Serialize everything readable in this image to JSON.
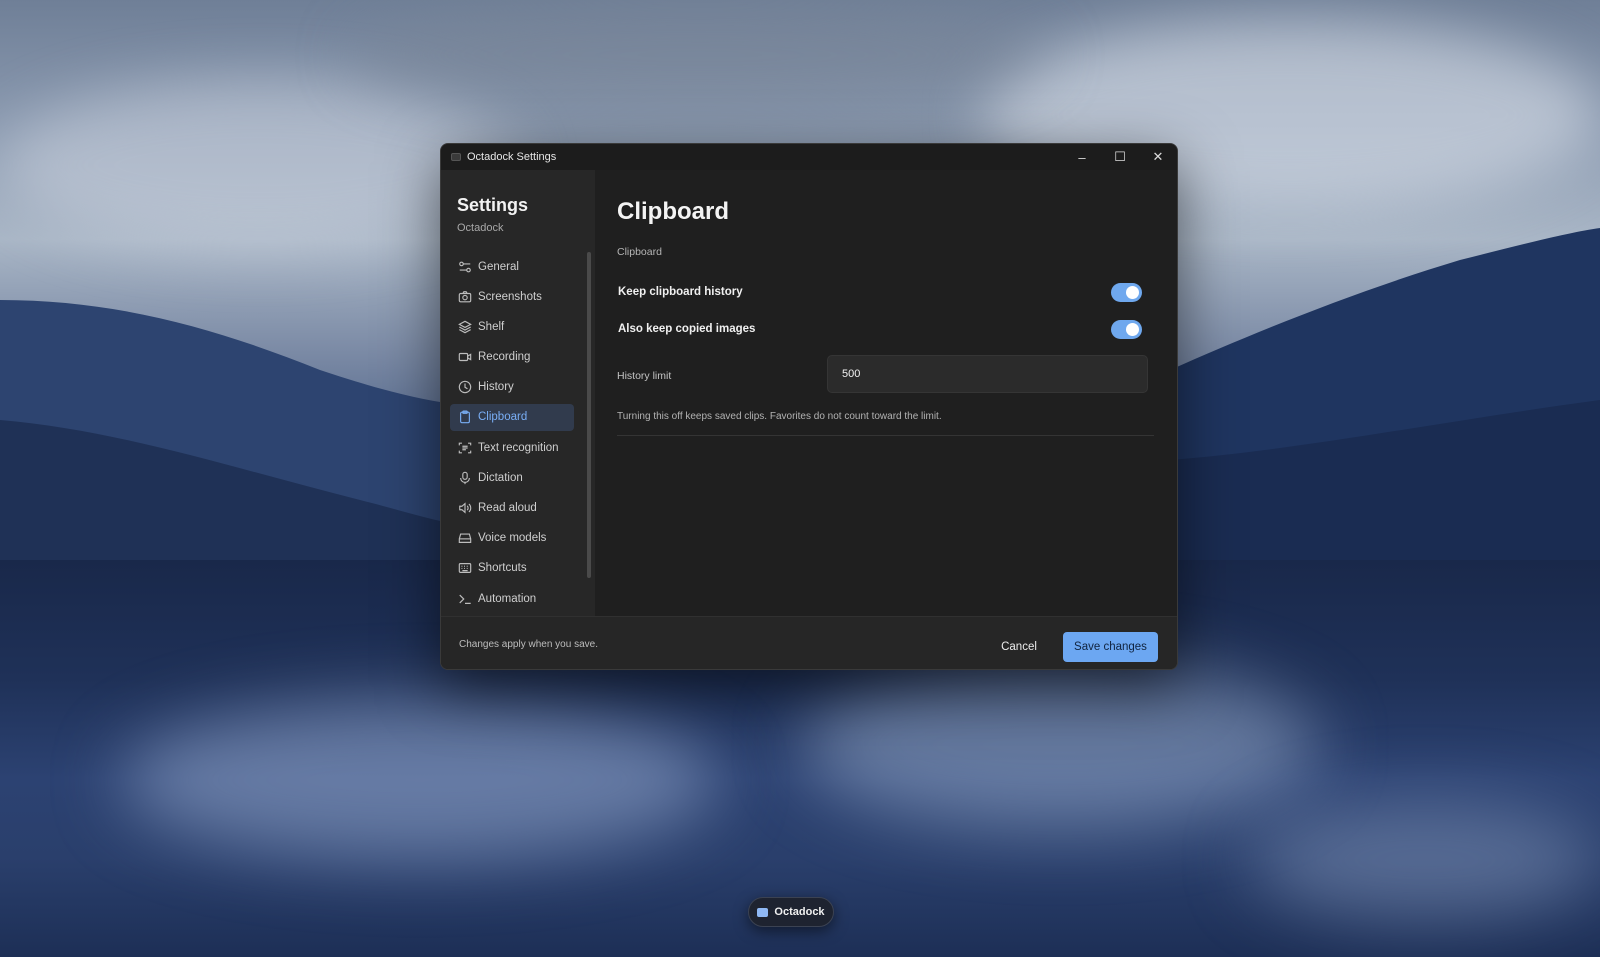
{
  "window": {
    "title": "Octadock Settings",
    "controls": {
      "minimize": "–",
      "maximize": "☐",
      "close": "✕"
    }
  },
  "sidebar": {
    "title": "Settings",
    "subtitle": "Octadock",
    "items": [
      {
        "label": "General",
        "icon": "sliders-icon"
      },
      {
        "label": "Screenshots",
        "icon": "camera-icon"
      },
      {
        "label": "Shelf",
        "icon": "layers-icon"
      },
      {
        "label": "Recording",
        "icon": "video-icon"
      },
      {
        "label": "History",
        "icon": "clock-icon"
      },
      {
        "label": "Clipboard",
        "icon": "clipboard-icon",
        "active": true
      },
      {
        "label": "Text recognition",
        "icon": "scan-text-icon"
      },
      {
        "label": "Dictation",
        "icon": "microphone-icon"
      },
      {
        "label": "Read aloud",
        "icon": "speaker-icon"
      },
      {
        "label": "Voice models",
        "icon": "drive-icon"
      },
      {
        "label": "Shortcuts",
        "icon": "keyboard-icon"
      },
      {
        "label": "Automation",
        "icon": "terminal-icon"
      }
    ]
  },
  "main": {
    "title": "Clipboard",
    "section_label": "Clipboard",
    "keep_history": {
      "label": "Keep clipboard history",
      "enabled": true
    },
    "keep_images": {
      "label": "Also keep copied images",
      "enabled": true
    },
    "history_limit": {
      "label": "History limit",
      "value": "500"
    },
    "hint": "Turning this off keeps saved clips. Favorites do not count toward the limit."
  },
  "footer": {
    "note": "Changes apply when you save.",
    "cancel_label": "Cancel",
    "save_label": "Save changes"
  },
  "taskbar": {
    "app_label": "Octadock"
  },
  "colors": {
    "accent": "#6ca7f2",
    "active_nav_bg": "#313b4d",
    "active_nav_text": "#79aef5",
    "window_bg": "#202020"
  }
}
